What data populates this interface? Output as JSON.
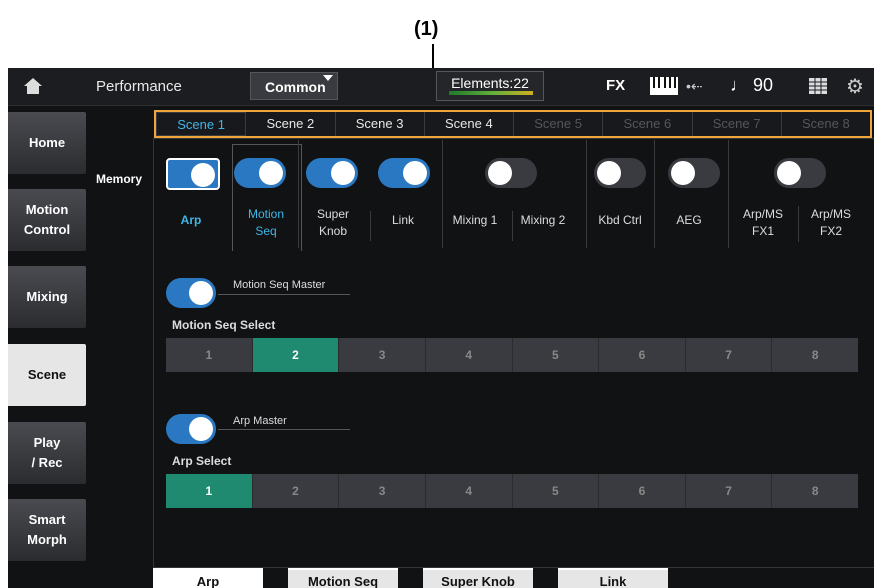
{
  "callout": "(1)",
  "topbar": {
    "title": "Performance",
    "common": "Common",
    "elements": "Elements:22",
    "fx": "FX",
    "tempo": "♩ 90"
  },
  "sidebar": {
    "items": [
      {
        "label": "Home"
      },
      {
        "label": "Motion\nControl"
      },
      {
        "label": "Mixing"
      },
      {
        "label": "Scene",
        "active": true
      },
      {
        "label": "Play\n/ Rec"
      },
      {
        "label": "Smart\nMorph"
      }
    ]
  },
  "scenes": [
    "Scene 1",
    "Scene 2",
    "Scene 3",
    "Scene 4",
    "Scene 5",
    "Scene 6",
    "Scene 7",
    "Scene 8"
  ],
  "memory": {
    "label": "Memory",
    "items": [
      {
        "label": "Arp",
        "on": true
      },
      {
        "label": "Motion\nSeq",
        "on": true
      },
      {
        "label": "Super\nKnob",
        "on": true
      },
      {
        "label": "Link",
        "on": true
      },
      {
        "label": "Mixing 1",
        "on": false
      },
      {
        "label": "Mixing 2",
        "on": false
      },
      {
        "label": "Kbd Ctrl",
        "on": false
      },
      {
        "label": "AEG",
        "on": false
      },
      {
        "label": "Arp/MS\nFX1",
        "on": false
      },
      {
        "label": "Arp/MS\nFX2",
        "on": false
      }
    ]
  },
  "motion_seq": {
    "master_label": "Motion Seq Master",
    "select_label": "Motion Seq Select",
    "options": [
      "1",
      "2",
      "3",
      "4",
      "5",
      "6",
      "7",
      "8"
    ],
    "selected": "2"
  },
  "arp": {
    "master_label": "Arp Master",
    "select_label": "Arp Select",
    "options": [
      "1",
      "2",
      "3",
      "4",
      "5",
      "6",
      "7",
      "8"
    ],
    "selected": "1"
  },
  "bottom_tabs": [
    "Arp",
    "Motion Seq",
    "Super Knob",
    "Link"
  ],
  "colors": {
    "accent": "#3fb6e6",
    "toggle_on": "#2a78c2",
    "selected_segment": "#1f8a70",
    "callout_border": "#f0a63a"
  }
}
